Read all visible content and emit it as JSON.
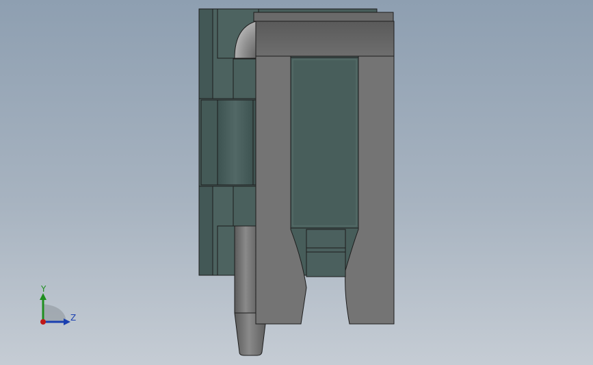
{
  "scene": {
    "background_top": "#8e9fb1",
    "background_bottom": "#c5ccd4",
    "part_color_dark": "#4a5f5c",
    "part_color_gray": "#6f6f6f"
  },
  "triad": {
    "y_label": "Y",
    "z_label": "Z",
    "y_color": "#1f8f1f",
    "z_color": "#1a3fb0",
    "origin_color": "#c01818"
  }
}
